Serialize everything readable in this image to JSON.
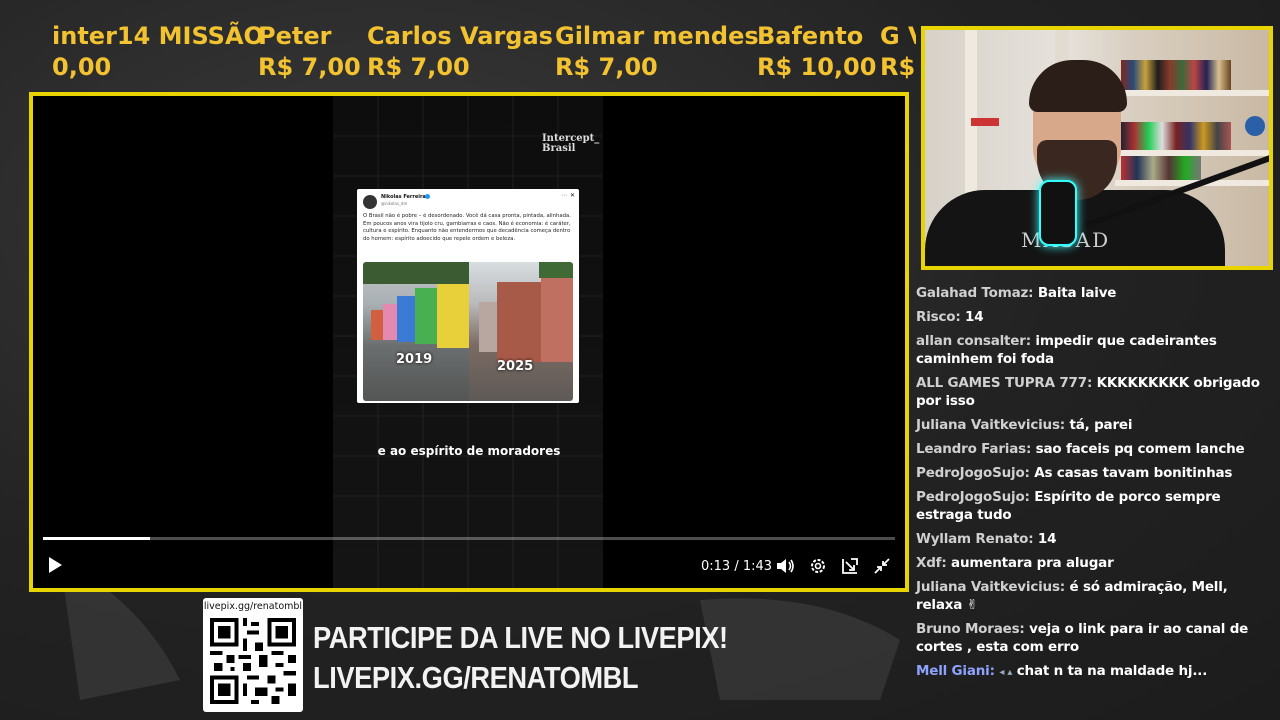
{
  "donations": [
    {
      "name": "inter14 MISSÃO",
      "amount": "0,00"
    },
    {
      "name": "Peter",
      "amount": "R$ 7,00"
    },
    {
      "name": "Carlos Vargas",
      "amount": "R$ 7,00"
    },
    {
      "name": "Gilmar mendes",
      "amount": "R$ 7,00"
    },
    {
      "name": "Bafento",
      "amount": "R$ 10,00"
    },
    {
      "name": "G V",
      "amount": "R$"
    }
  ],
  "video": {
    "watermark": "Intercept_ Brasil",
    "tweet": {
      "author": "Nikolas Ferreira",
      "handle": "@nikolas_dm",
      "text": "O Brasil não é pobre – é desordenado. Você dá casa pronta, pintada, alinhada. Em poucos anos vira tijolo cru, gambiarras e caos. Não é economia: é caráter, cultura e espírito. Enquanto não entendermos que decadência começa dentro do homem: espírito adoecido que repele ordem e beleza.",
      "year_left": "2019",
      "year_right": "2025"
    },
    "caption": "e ao espírito de moradores",
    "progress": 0.126,
    "time": "0:13 / 1:43"
  },
  "webcam": {
    "shirt_text": "MASAD"
  },
  "chat": [
    {
      "user": "Galahad Tomaz:",
      "text": "Baita laive"
    },
    {
      "user": "Risco:",
      "text": "14"
    },
    {
      "user": "allan consalter:",
      "text": "impedir que cadeirantes caminhem foi foda"
    },
    {
      "user": "ALL GAMES TUPRA 777:",
      "text": "KKKKKKKKK obrigado por isso"
    },
    {
      "user": "Juliana Vaitkevicius:",
      "text": "tá, parei"
    },
    {
      "user": "Leandro Farias:",
      "text": "sao faceis pq comem lanche"
    },
    {
      "user": "PedroJogoSujo:",
      "text": "As casas tavam bonitinhas"
    },
    {
      "user": "PedroJogoSujo:",
      "text": "Espírito de porco sempre estraga tudo"
    },
    {
      "user": "Wyllam Renato:",
      "text": "14"
    },
    {
      "user": "Xdf:",
      "text": "aumentara pra alugar"
    },
    {
      "user": "Juliana Vaitkevicius:",
      "text": "é só admiração, Mell, relaxa ✌"
    },
    {
      "user": "Bruno Moraes:",
      "text": "veja o link para ir ao canal de cortes , esta com erro"
    },
    {
      "user": "Mell Giani:",
      "text": "chat n ta na maldade hj...",
      "highlight": true
    }
  ],
  "livepix": {
    "qr_url": "livepix.gg/renatombl",
    "line1": "PARTICIPE DA LIVE NO LIVEPIX!",
    "line2": "LIVEPIX.GG/RENATOMBL"
  },
  "colors": {
    "frame": "#e8d400",
    "donation_text": "#f2c230",
    "highlight_user": "#8ea3ff"
  }
}
